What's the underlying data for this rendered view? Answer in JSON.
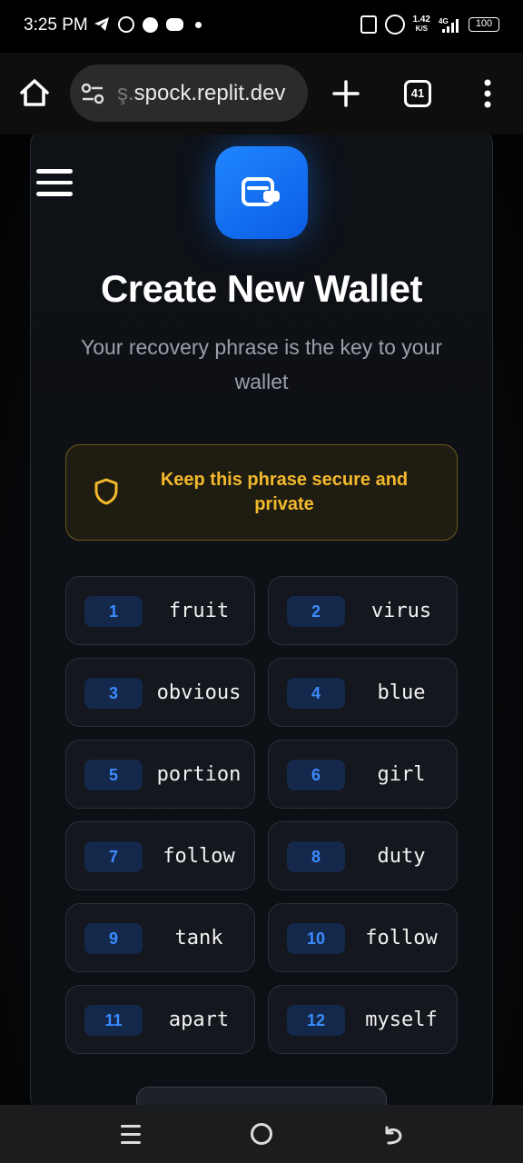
{
  "status_bar": {
    "time": "3:25 PM",
    "net_speed_value": "1.42",
    "net_speed_unit": "K/S",
    "network_type": "4G",
    "battery": "100",
    "left_icons": [
      "telegram-icon",
      "whatsapp-icon",
      "message-icon",
      "game-icon",
      "dot-icon"
    ],
    "right_icons": [
      "vibrate-icon",
      "hotspot-icon",
      "signal-icon",
      "battery-icon"
    ]
  },
  "browser": {
    "url": "spock.replit.dev",
    "url_prefix": "ş.",
    "tab_count": "41"
  },
  "page": {
    "title": "Create New Wallet",
    "subtitle": "Your recovery phrase is the key to your wallet",
    "warning": "Keep this phrase secure and private",
    "accent_color": "#1f86ff",
    "warning_color": "#f3b92d",
    "words": [
      {
        "num": "1",
        "word": "fruit"
      },
      {
        "num": "2",
        "word": "virus"
      },
      {
        "num": "3",
        "word": "obvious"
      },
      {
        "num": "4",
        "word": "blue"
      },
      {
        "num": "5",
        "word": "portion"
      },
      {
        "num": "6",
        "word": "girl"
      },
      {
        "num": "7",
        "word": "follow"
      },
      {
        "num": "8",
        "word": "duty"
      },
      {
        "num": "9",
        "word": "tank"
      },
      {
        "num": "10",
        "word": "follow"
      },
      {
        "num": "11",
        "word": "apart"
      },
      {
        "num": "12",
        "word": "myself"
      }
    ]
  }
}
